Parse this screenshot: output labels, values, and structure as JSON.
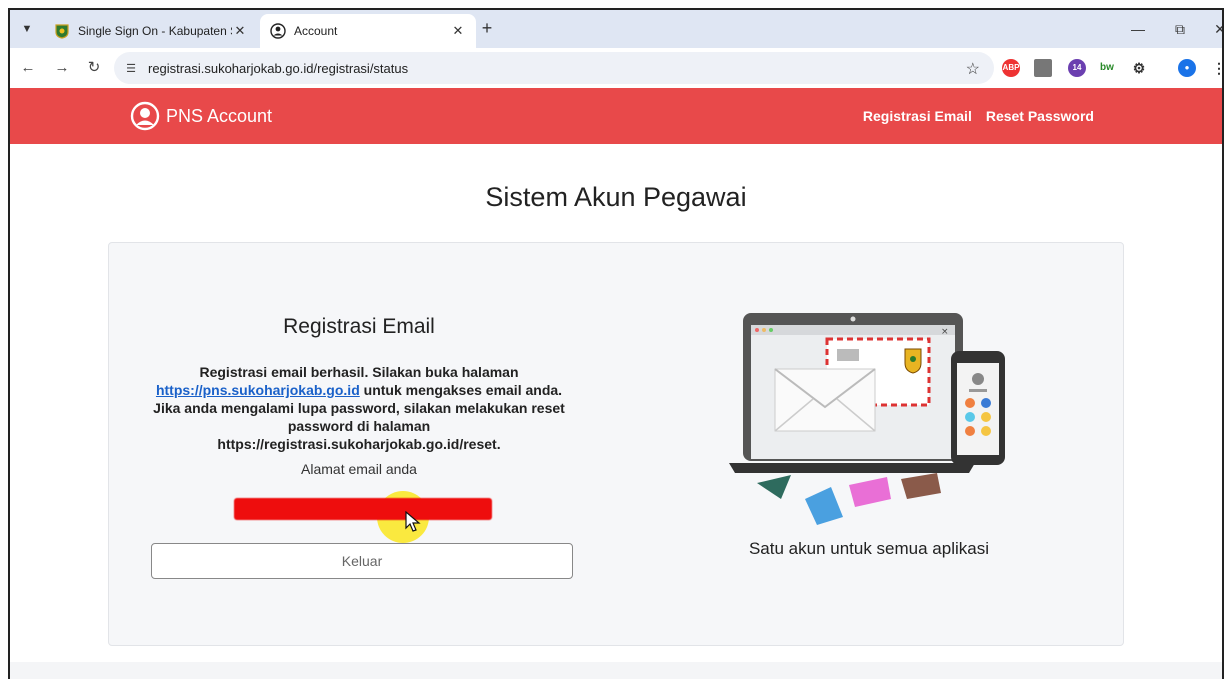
{
  "browser": {
    "tabs": [
      {
        "title": "Single Sign On - Kabupaten Suk",
        "active": false
      },
      {
        "title": "Account",
        "active": true
      }
    ],
    "url": "registrasi.sukoharjokab.go.id/registrasi/status",
    "extensions": [
      "ABP",
      "14",
      "bw"
    ]
  },
  "nav": {
    "brand": "PNS Account",
    "links": [
      "Registrasi Email",
      "Reset Password"
    ],
    "color": "#e8494a"
  },
  "main": {
    "page_title": "Sistem Akun Pegawai",
    "card": {
      "heading": "Registrasi Email",
      "msg_line1": "Registrasi email berhasil. Silakan buka halaman",
      "msg_link": "https://pns.sukoharjokab.go.id",
      "msg_after_link": " untuk mengakses email anda.",
      "msg_line3": "Jika anda mengalami lupa password, silakan melakukan reset",
      "msg_line4": "password di halaman",
      "msg_line5": "https://registrasi.sukoharjokab.go.id/reset.",
      "email_label": "Alamat email anda",
      "logout_label": "Keluar",
      "tagline": "Satu akun untuk semua aplikasi"
    }
  }
}
